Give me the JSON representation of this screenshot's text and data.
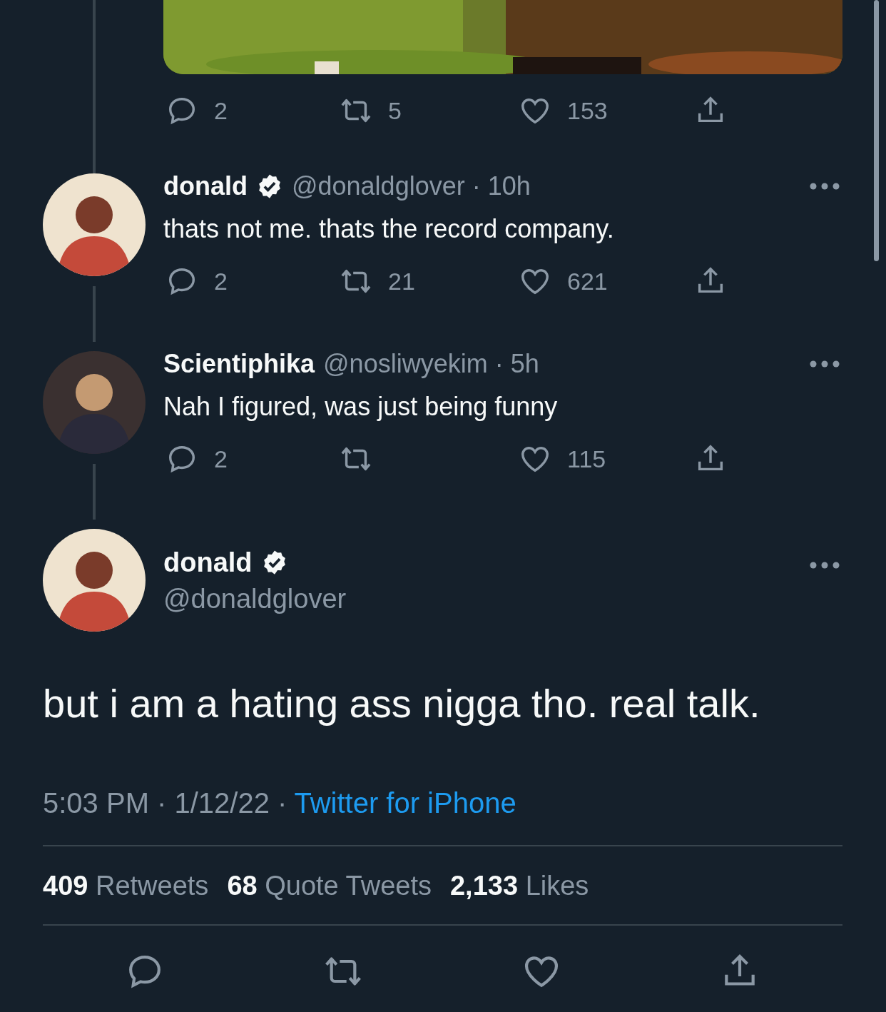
{
  "media_tweet": {
    "actions": {
      "replies": "2",
      "retweets": "5",
      "likes": "153"
    }
  },
  "replies": [
    {
      "name": "donald",
      "verified": true,
      "meta": "@donaldglover · 10h",
      "text": "thats not me. thats the record company.",
      "actions": {
        "replies": "2",
        "retweets": "21",
        "likes": "621"
      }
    },
    {
      "name": "Scientiphika",
      "verified": false,
      "meta": "@nosliwyekim · 5h",
      "text": "Nah I figured, was just being funny",
      "actions": {
        "replies": "2",
        "likes": "115"
      }
    }
  ],
  "main_tweet": {
    "name": "donald",
    "verified": true,
    "handle": "@donaldglover",
    "text": "but i am a hating ass nigga tho. real talk.",
    "timestamp": "5:03 PM · 1/12/22 ·",
    "source": "Twitter for iPhone",
    "stats": [
      {
        "count": "409",
        "label": "Retweets"
      },
      {
        "count": "68",
        "label": "Quote Tweets"
      },
      {
        "count": "2,133",
        "label": "Likes"
      }
    ]
  }
}
